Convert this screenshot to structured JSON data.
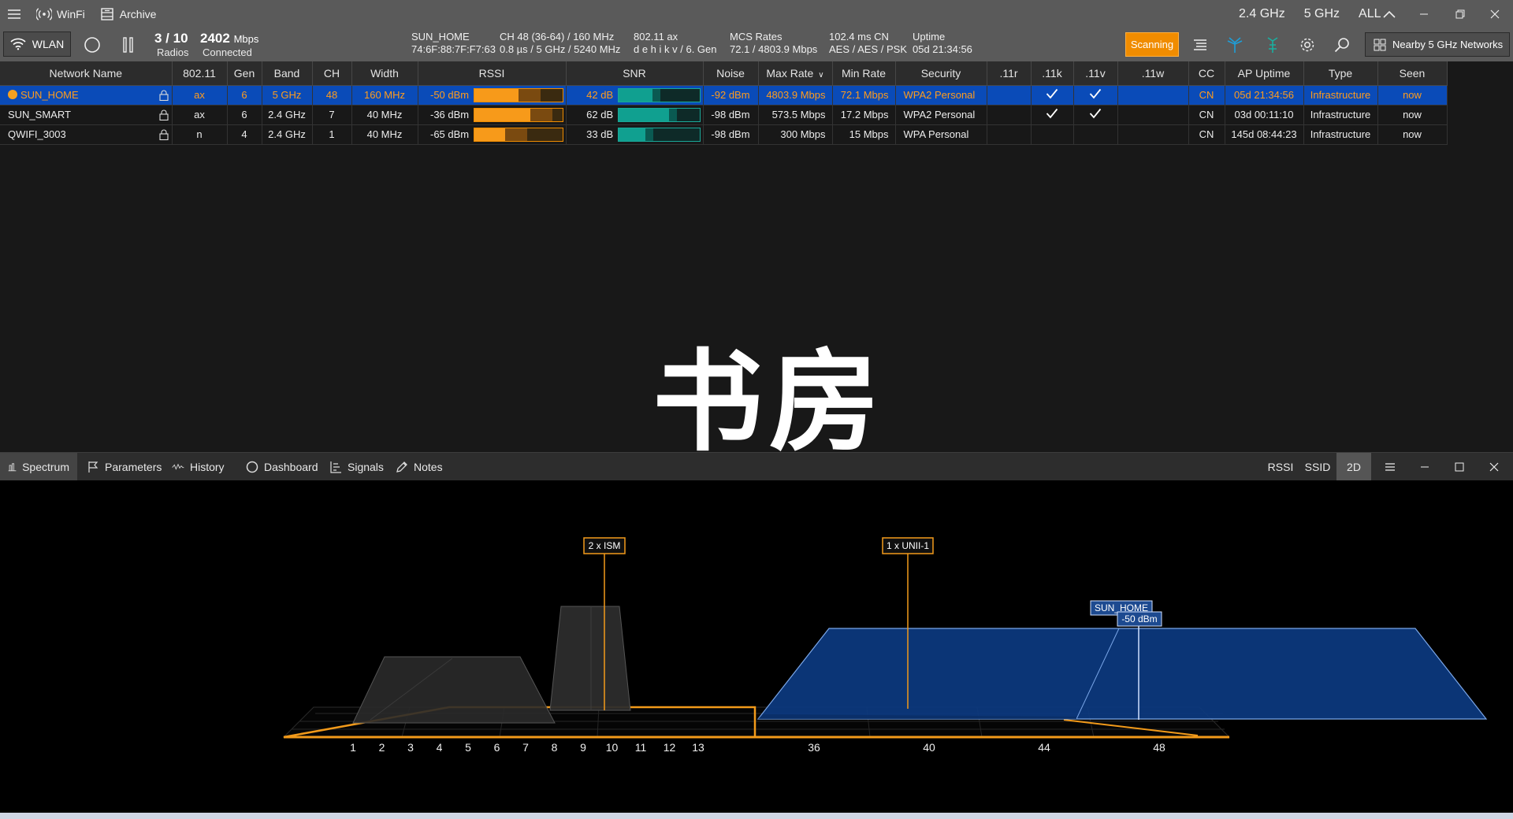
{
  "titlebar": {
    "app_name": "WinFi",
    "archive_label": "Archive",
    "band_24": "2.4 GHz",
    "band_5": "5 GHz",
    "band_all": "ALL"
  },
  "toolbar": {
    "wlan_label": "WLAN",
    "radios_value": "3 / 10",
    "radios_label": "Radios",
    "speed_value": "2402",
    "speed_unit": "Mbps",
    "speed_label": "Connected",
    "ssid": "SUN_HOME",
    "bssid": "74:6F:88:7F:F7:63",
    "channel_line1": "CH  48 (36-64)  /  160 MHz",
    "channel_line2": "0.8 µs / 5 GHz / 5240 MHz",
    "standard_line1": "802.11 ax",
    "standard_line2": "d  e h i k v / 6. Gen",
    "mcs_line1": "MCS Rates",
    "mcs_line2": "72.1 / 4803.9 Mbps",
    "latency_line1": "102.4 ms   CN",
    "latency_line2": "AES / AES / PSK",
    "uptime_line1": "Uptime",
    "uptime_line2": "05d 21:34:56",
    "scan_label": "Scanning",
    "nearby_label": "Nearby 5 GHz Networks"
  },
  "colors": {
    "accent": "#f08c00",
    "selected_row": "#0a4bb8",
    "snr": "#10a090",
    "spectrum_fill": "#0c3a80"
  },
  "table": {
    "headers": [
      "Network Name",
      "802.11",
      "Gen",
      "Band",
      "CH",
      "Width",
      "RSSI",
      "SNR",
      "Noise",
      "Max Rate",
      "Min Rate",
      "Security",
      ".11r",
      ".11k",
      ".11v",
      ".11w",
      "CC",
      "AP Uptime",
      "Type",
      "Seen"
    ],
    "rows": [
      {
        "name": "SUN_HOME",
        "std": "ax",
        "gen": "6",
        "band": "5 GHz",
        "ch": "48",
        "width": "160 MHz",
        "rssi": "-50 dBm",
        "rssi_pct": 50,
        "snr": "42 dB",
        "snr_pct": 42,
        "noise": "-92 dBm",
        "max_rate": "4803.9 Mbps",
        "min_rate": "72.1 Mbps",
        "security": "WPA2 Personal",
        "r11": "",
        "k11": true,
        "v11": true,
        "w11": "",
        "cc": "CN",
        "uptime": "05d 21:34:56",
        "type": "Infrastructure",
        "seen": "now",
        "selected": true
      },
      {
        "name": "SUN_SMART",
        "std": "ax",
        "gen": "6",
        "band": "2.4 GHz",
        "ch": "7",
        "width": "40 MHz",
        "rssi": "-36 dBm",
        "rssi_pct": 64,
        "snr": "62 dB",
        "snr_pct": 62,
        "noise": "-98 dBm",
        "max_rate": "573.5 Mbps",
        "min_rate": "17.2 Mbps",
        "security": "WPA2 Personal",
        "r11": "",
        "k11": true,
        "v11": true,
        "w11": "",
        "cc": "CN",
        "uptime": "03d 00:11:10",
        "type": "Infrastructure",
        "seen": "now",
        "selected": false
      },
      {
        "name": "QWIFI_3003",
        "std": "n",
        "gen": "4",
        "band": "2.4 GHz",
        "ch": "1",
        "width": "40 MHz",
        "rssi": "-65 dBm",
        "rssi_pct": 35,
        "snr": "33 dB",
        "snr_pct": 33,
        "noise": "-98 dBm",
        "max_rate": "300 Mbps",
        "min_rate": "15 Mbps",
        "security": "WPA Personal",
        "r11": "",
        "k11": false,
        "v11": false,
        "w11": "",
        "cc": "CN",
        "uptime": "145d 08:44:23",
        "type": "Infrastructure",
        "seen": "now",
        "selected": false
      }
    ]
  },
  "watermark": "书房",
  "bottom_tabs": [
    "Spectrum",
    "Parameters",
    "History",
    "Dashboard",
    "Signals",
    "Notes"
  ],
  "right_tabs": {
    "rssi": "RSSI",
    "ssid": "SSID",
    "mode": "2D"
  },
  "spectrum": {
    "ism_label": "2 x ISM",
    "unii_label": "1 x UNII-1",
    "net_label": "SUN_HOME",
    "net_rssi": "-50 dBm",
    "channels_24": [
      "1",
      "2",
      "3",
      "4",
      "5",
      "6",
      "7",
      "8",
      "9",
      "10",
      "11",
      "12",
      "13"
    ],
    "channels_5": [
      "36",
      "40",
      "44",
      "48"
    ]
  }
}
